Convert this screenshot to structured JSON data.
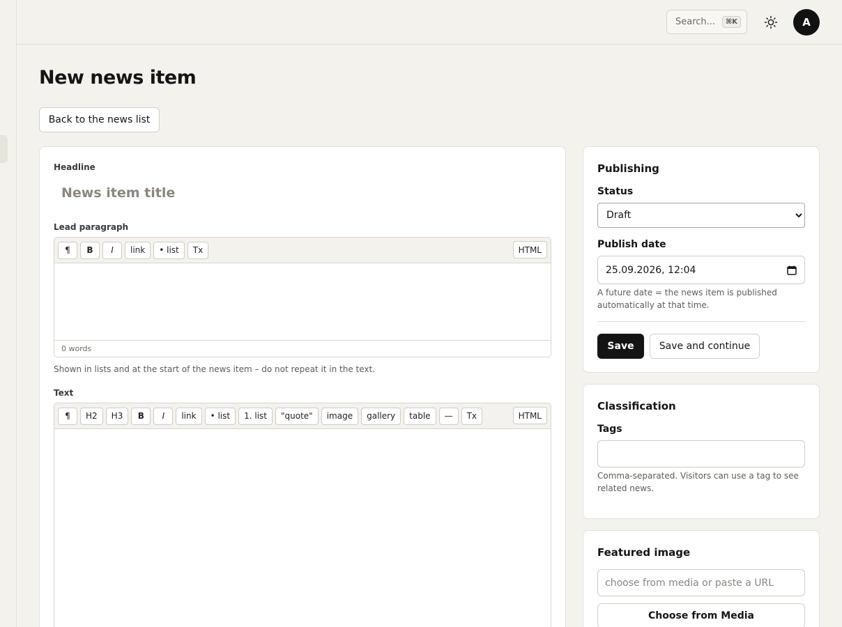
{
  "topbar": {
    "search_placeholder": "Search...",
    "search_shortcut": "⌘K",
    "avatar_initial": "A"
  },
  "page": {
    "title": "New news item",
    "back_button": "Back to the news list"
  },
  "main": {
    "headline_label": "Headline",
    "headline_placeholder": "News item title",
    "lead_label": "Lead paragraph",
    "lead_toolbar": [
      "¶",
      "B",
      "I",
      "link",
      "• list",
      "Tx"
    ],
    "lead_html_button": "HTML",
    "lead_word_count": "0 words",
    "lead_hint": "Shown in lists and at the start of the news item – do not repeat it in the text.",
    "text_label": "Text",
    "text_toolbar": [
      "¶",
      "H2",
      "H3",
      "B",
      "I",
      "link",
      "• list",
      "1. list",
      "\"quote\"",
      "image",
      "gallery",
      "table",
      "—",
      "Tx"
    ],
    "text_html_button": "HTML"
  },
  "publishing": {
    "title": "Publishing",
    "status_label": "Status",
    "status_value": "Draft",
    "date_label": "Publish date",
    "date_value": "25.09.2026, 12:04",
    "date_hint": "A future date = the news item is published automatically at that time.",
    "save_button": "Save",
    "save_continue_button": "Save and continue"
  },
  "classification": {
    "title": "Classification",
    "tags_label": "Tags",
    "tags_value": "",
    "tags_hint": "Comma-separated. Visitors can use a tag to see related news."
  },
  "featured_image": {
    "title": "Featured image",
    "url_placeholder": "choose from media or paste a URL",
    "choose_button": "Choose from Media"
  },
  "colors": {
    "background": "#f4f2ec",
    "primary_button": "#141414",
    "card": "#ffffff"
  }
}
